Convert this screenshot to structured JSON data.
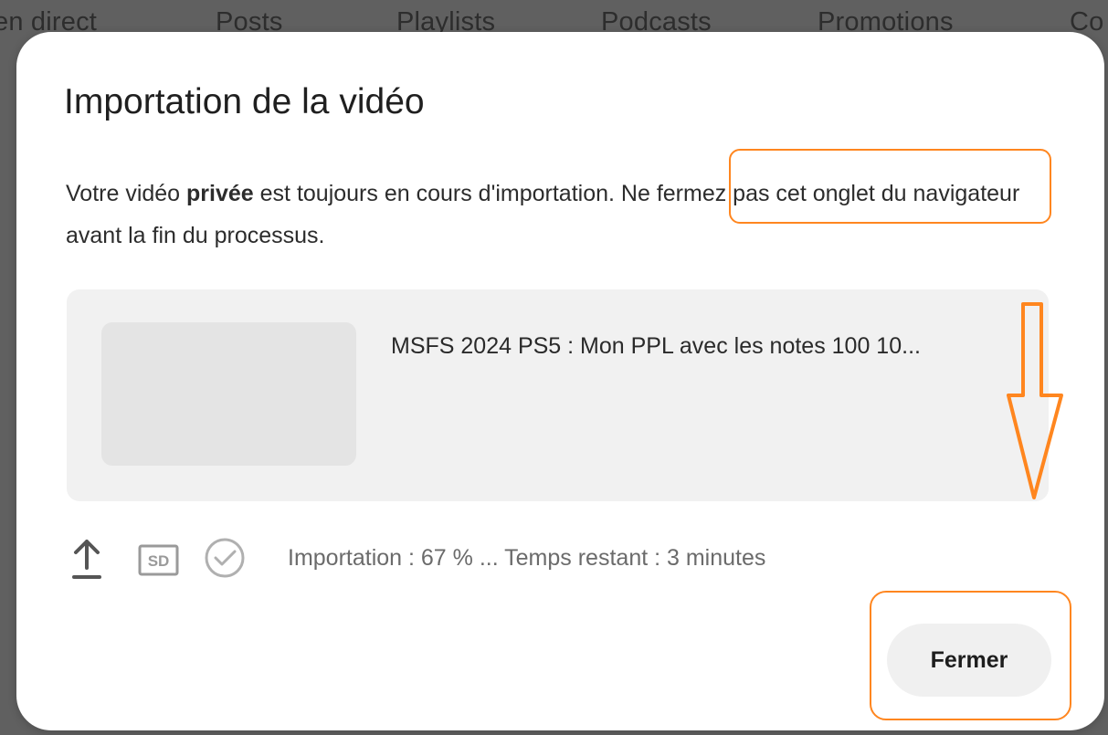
{
  "background": {
    "tabs": [
      {
        "label": "en direct"
      },
      {
        "label": "Posts"
      },
      {
        "label": "Playlists"
      },
      {
        "label": "Podcasts"
      },
      {
        "label": "Promotions"
      },
      {
        "label": "Co"
      }
    ]
  },
  "dialog": {
    "title": "Importation de la vidéo",
    "message_before": "Votre vidéo ",
    "message_privacy": "privée",
    "message_middle": " est toujours en cours d'importation.",
    "message_highlighted": " Ne fermez pas cet onglet du navigateur avant la fin du processus.",
    "video_title": "MSFS 2024 PS5 : Mon PPL avec les notes 100 10...",
    "status": {
      "text": "Importation : 67 % ... Temps restant : 3 minutes",
      "progress_percent": 67,
      "quality_badge": "SD",
      "icons": [
        "upload-icon",
        "sd-badge-icon",
        "check-circle-icon"
      ]
    },
    "close_button": "Fermer"
  },
  "annotations": {
    "color": "#ff861f"
  },
  "colors": {
    "overlay": "#606060",
    "dialog_background": "#ffffff",
    "card_background": "#f1f1f1",
    "thumbnail": "#e4e4e4",
    "button_background": "#f0f0f0"
  }
}
